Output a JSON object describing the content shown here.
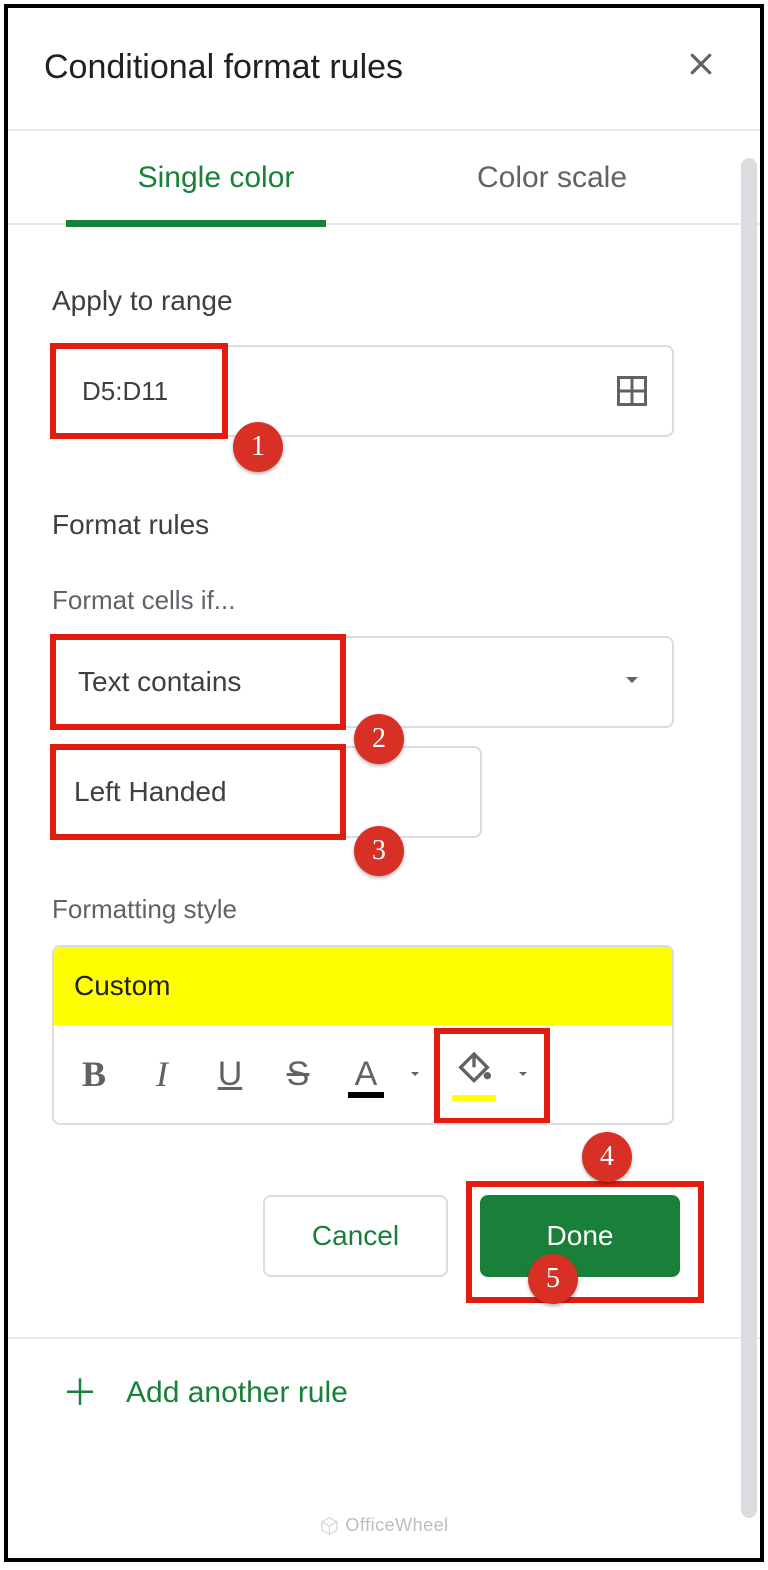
{
  "header": {
    "title": "Conditional format rules"
  },
  "tabs": {
    "single": "Single color",
    "scale": "Color scale"
  },
  "range": {
    "section": "Apply to range",
    "value": "D5:D11"
  },
  "rules": {
    "section": "Format rules",
    "label": "Format cells if...",
    "condition": "Text contains",
    "value": "Left Handed"
  },
  "style": {
    "label": "Formatting style",
    "preview": "Custom",
    "preview_bg": "#ffff00"
  },
  "buttons": {
    "cancel": "Cancel",
    "done": "Done"
  },
  "addRule": "Add another rule",
  "badges": {
    "b1": "1",
    "b2": "2",
    "b3": "3",
    "b4": "4",
    "b5": "5"
  },
  "watermark": "OfficeWheel"
}
